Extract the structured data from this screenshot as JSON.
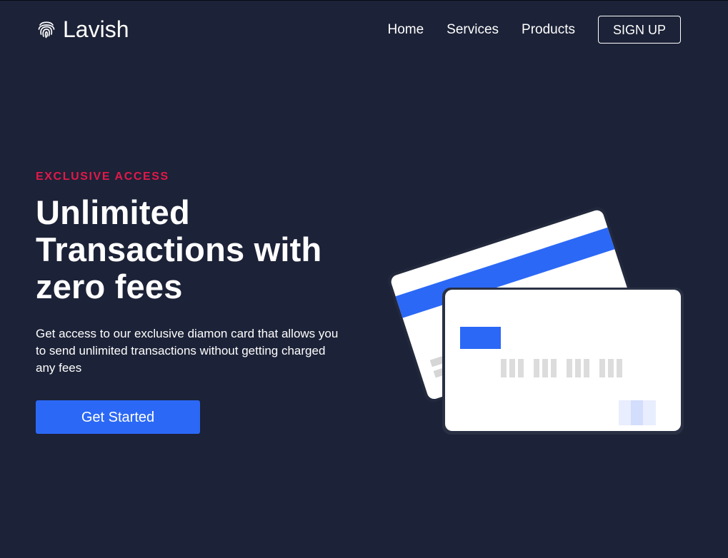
{
  "brand": {
    "name": "Lavish",
    "icon": "fingerprint-icon"
  },
  "nav": {
    "links": [
      {
        "label": "Home"
      },
      {
        "label": "Services"
      },
      {
        "label": "Products"
      }
    ],
    "signup_label": "SIGN UP"
  },
  "hero": {
    "eyebrow": "EXCLUSIVE ACCESS",
    "headline_lines": [
      "Unlimited",
      "Transactions with",
      "zero fees"
    ],
    "description": "Get access to our exclusive diamon card that allows you to send unlimited transactions without getting charged any fees",
    "cta_label": "Get Started"
  },
  "illustration": {
    "icon": "credit-cards-illustration"
  },
  "colors": {
    "background": "#1c2237",
    "accent": "#e3184a",
    "primary": "#2b68f6",
    "text": "#ffffff"
  }
}
